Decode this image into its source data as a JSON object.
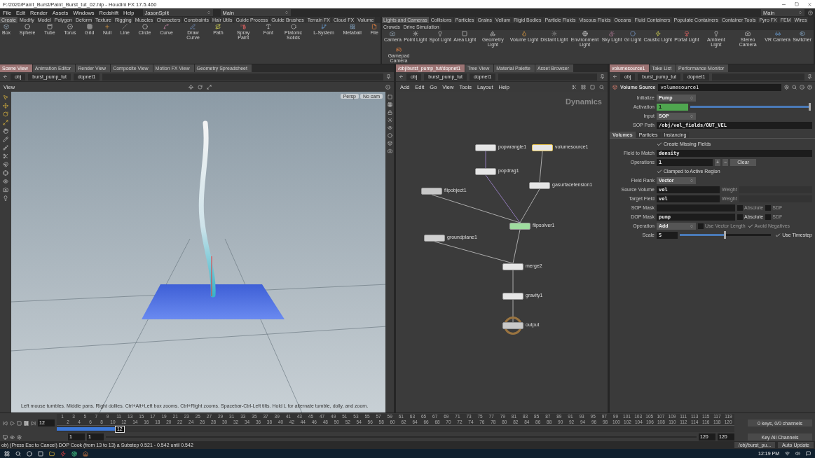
{
  "window": {
    "title": "F:/2020/Paint_Burst/Paint_Burst_tut_02.hip - Houdini FX 17.5.460"
  },
  "menu_bar": {
    "items": [
      "File",
      "Edit",
      "Render",
      "Assets",
      "Windows",
      "Redshift",
      "Help"
    ],
    "selectors": [
      "JasonSplit",
      "Main"
    ],
    "right_selector": "Main"
  },
  "shelves": [
    {
      "tabs": [
        {
          "label": "Create",
          "selected": true
        },
        {
          "label": "Modify",
          "selected": false
        },
        {
          "label": "Model",
          "selected": false
        },
        {
          "label": "Polygon",
          "selected": false
        },
        {
          "label": "Deform",
          "selected": false
        },
        {
          "label": "Texture",
          "selected": false
        },
        {
          "label": "Rigging",
          "selected": false
        },
        {
          "label": "Muscles",
          "selected": false
        },
        {
          "label": "Characters",
          "selected": false
        },
        {
          "label": "Constraints",
          "selected": false
        },
        {
          "label": "Hair Utils",
          "selected": false
        },
        {
          "label": "Guide Process",
          "selected": false
        },
        {
          "label": "Guide Brushes",
          "selected": false
        },
        {
          "label": "Terrain FX",
          "selected": false
        },
        {
          "label": "Cloud FX",
          "selected": false
        },
        {
          "label": "Volume",
          "selected": false
        }
      ],
      "tools": [
        "Box",
        "Sphere",
        "Tube",
        "Torus",
        "Grid",
        "Null",
        "Line",
        "Circle",
        "Curve",
        "Draw Curve",
        "Path",
        "Spray Paint",
        "Font",
        "Platonic Solids",
        "L-System",
        "Metaball",
        "File"
      ]
    },
    {
      "tabs": [
        {
          "label": "Lights and Cameras",
          "selected": true
        },
        {
          "label": "Collisions",
          "selected": false
        },
        {
          "label": "Particles",
          "selected": false
        },
        {
          "label": "Grains",
          "selected": false
        },
        {
          "label": "Vellum",
          "selected": false
        },
        {
          "label": "Rigid Bodies",
          "selected": false
        },
        {
          "label": "Particle Fluids",
          "selected": false
        },
        {
          "label": "Viscous Fluids",
          "selected": false
        },
        {
          "label": "Oceans",
          "selected": false
        },
        {
          "label": "Fluid Containers",
          "selected": false
        },
        {
          "label": "Populate Containers",
          "selected": false
        },
        {
          "label": "Container Tools",
          "selected": false
        },
        {
          "label": "Pyro FX",
          "selected": false
        },
        {
          "label": "FEM",
          "selected": false
        },
        {
          "label": "Wires",
          "selected": false
        },
        {
          "label": "Crowds",
          "selected": false
        },
        {
          "label": "Drive Simulation",
          "selected": false
        }
      ],
      "tools": [
        "Camera",
        "Point Light",
        "Spot Light",
        "Area Light",
        "Geometry Light",
        "Volume Light",
        "Distant Light",
        "Environment Light",
        "Sky Light",
        "GI Light",
        "Caustic Light",
        "Portal Light",
        "Ambient Light",
        "Stereo Camera",
        "VR Camera",
        "Switcher",
        "Gamepad Camera"
      ]
    }
  ],
  "panes": [
    {
      "tabs": [
        {
          "label": "Scene View",
          "selected": true
        },
        {
          "label": "Animation Editor",
          "selected": false
        },
        {
          "label": "Render View",
          "selected": false
        },
        {
          "label": "Composite View",
          "selected": false
        },
        {
          "label": "Motion FX View",
          "selected": false
        },
        {
          "label": "Geometry Spreadsheet",
          "selected": false
        }
      ],
      "path": [
        "obj",
        "burst_pump_tut",
        "dopnet1"
      ]
    },
    {
      "tabs": [
        {
          "label": "/obj/burst_pump_tut/dopnet1",
          "selected": true
        },
        {
          "label": "Tree View",
          "selected": false
        },
        {
          "label": "Material Palette",
          "selected": false
        },
        {
          "label": "Asset Browser",
          "selected": false
        }
      ],
      "path": [
        "obj",
        "burst_pump_tut",
        "dopnet1"
      ]
    },
    {
      "tabs": [
        {
          "label": "volumesource1",
          "selected": true
        },
        {
          "label": "Take List",
          "selected": false
        },
        {
          "label": "Performance Monitor",
          "selected": false
        }
      ],
      "path": [
        "obj",
        "burst_pump_tut",
        "dopnet1"
      ]
    }
  ],
  "viewport": {
    "header": "View",
    "camera": "Persp",
    "camera_lock": "No cam",
    "hint": "Left mouse tumbles. Middle pans. Right dollies. Ctrl+Alt+Left box zooms. Ctrl+Right zooms. Spacebar-Ctrl-Left tilts. Hold L for alternate tumble, dolly, and zoom."
  },
  "network": {
    "menu": [
      "Add",
      "Edit",
      "Go",
      "View",
      "Tools",
      "Layout",
      "Help"
    ],
    "context": "Dynamics",
    "nodes": [
      {
        "name": "popwrangle1",
        "selected": false,
        "display": false,
        "color": "#e6e6e6"
      },
      {
        "name": "volumesource1",
        "selected": true,
        "display": false,
        "color": "#e6e6e6"
      },
      {
        "name": "popdrag1",
        "selected": false,
        "display": false,
        "color": "#e6e6e6"
      },
      {
        "name": "gasurfacetension1",
        "selected": false,
        "display": false,
        "color": "#e6e6e6"
      },
      {
        "name": "flipobject1",
        "selected": false,
        "display": false,
        "color": "#c8c8c8"
      },
      {
        "name": "flipsolver1",
        "selected": false,
        "display": false,
        "color": "#9fdc9f"
      },
      {
        "name": "groundplane1",
        "selected": false,
        "display": false,
        "color": "#d0d0d0"
      },
      {
        "name": "merge2",
        "selected": false,
        "display": false,
        "color": "#e6e6e6"
      },
      {
        "name": "gravity1",
        "selected": false,
        "display": false,
        "color": "#e6e6e6"
      },
      {
        "name": "output",
        "selected": false,
        "display": true,
        "color": "#c8c8c8"
      }
    ]
  },
  "parameters": {
    "type": "Volume Source",
    "name": "volumesource1",
    "top_rows": [
      {
        "kind": "menu",
        "label": "Initialize",
        "value": "Pump"
      },
      {
        "kind": "slider",
        "label": "Activation",
        "value": "1",
        "level": 1,
        "animated": true
      },
      {
        "kind": "menu",
        "label": "Input",
        "value": "SOP"
      },
      {
        "kind": "field",
        "label": "SOP Path",
        "value": "/obj/vel_fields/OUT_VEL"
      }
    ],
    "tabs": [
      {
        "label": "Volumes",
        "selected": true
      },
      {
        "label": "Particles",
        "selected": false
      },
      {
        "label": "Instancing",
        "selected": false
      }
    ],
    "rows": [
      {
        "kind": "checkbox",
        "text": "Create Missing Fields",
        "checked": true
      },
      {
        "kind": "field",
        "label": "Field to Match",
        "value": "density"
      },
      {
        "kind": "multiparm",
        "label": "Operations",
        "value": "1",
        "buttons": [
          "+",
          "−"
        ],
        "action": "Clear"
      },
      {
        "kind": "checkbox",
        "text": "Clamped to Active Region",
        "checked": true
      },
      {
        "kind": "menu",
        "label": "Field Rank",
        "value": "Vector"
      },
      {
        "kind": "field",
        "label": "Source Volume",
        "value": "vel",
        "extra": "Weight"
      },
      {
        "kind": "field",
        "label": "Target Field",
        "value": "vel",
        "extra": "Weight"
      },
      {
        "kind": "field",
        "label": "SOP Mask",
        "options": [
          {
            "label": "Absolute",
            "checked": false,
            "disabled": true
          },
          {
            "label": "SDF",
            "checked": false,
            "disabled": true
          }
        ]
      },
      {
        "kind": "field",
        "label": "DOP Mask",
        "value": "pump",
        "options": [
          {
            "label": "Absolute",
            "checked": false,
            "disabled": false
          },
          {
            "label": "SDF",
            "checked": false,
            "disabled": true
          }
        ]
      },
      {
        "kind": "menu",
        "label": "Operation",
        "value": "Add",
        "options": [
          {
            "label": "Use Vector Length",
            "checked": false,
            "disabled": true
          },
          {
            "label": "Avoid Negatives",
            "checked": true,
            "disabled": true
          }
        ]
      },
      {
        "kind": "slider",
        "label": "Scale",
        "value": "5",
        "level": 0.5,
        "animated": false,
        "options": [
          {
            "label": "Use Timestep",
            "checked": true,
            "disabled": false
          }
        ]
      }
    ]
  },
  "timeline": {
    "playing": true,
    "frame": "12",
    "marker": "12",
    "level": 0.092,
    "ticks": [
      "1",
      "2",
      "3",
      "4",
      "5",
      "6",
      "7",
      "8",
      "9",
      "10",
      "11",
      "12",
      "13",
      "14",
      "15",
      "16",
      "17",
      "18",
      "19",
      "20",
      "21",
      "22",
      "23",
      "24",
      "25",
      "26",
      "27",
      "28",
      "29",
      "30",
      "31",
      "32",
      "33",
      "34",
      "35",
      "36",
      "37",
      "38",
      "39",
      "40",
      "41",
      "42",
      "43",
      "44",
      "45",
      "46",
      "47",
      "48",
      "49",
      "50",
      "51",
      "52",
      "53",
      "54",
      "55",
      "56",
      "57",
      "58",
      "59",
      "60",
      "61",
      "62",
      "63",
      "64",
      "65",
      "66",
      "67",
      "68",
      "69",
      "70",
      "71",
      "72",
      "73",
      "74",
      "75",
      "76",
      "77",
      "78",
      "79",
      "80",
      "81",
      "82",
      "83",
      "84",
      "85",
      "86",
      "87",
      "88",
      "89",
      "90",
      "91",
      "92",
      "93",
      "94",
      "95",
      "96",
      "97",
      "98",
      "99",
      "100",
      "101",
      "102",
      "103",
      "104",
      "105",
      "106",
      "107",
      "108",
      "109",
      "110",
      "111",
      "112",
      "113",
      "114",
      "115",
      "116",
      "117",
      "118",
      "119",
      "120"
    ],
    "range_start": [
      "1",
      "1"
    ],
    "range_end": [
      "120",
      "120"
    ],
    "keys": "0 keys, 0/0 channels",
    "key_mode": "Key All Channels"
  },
  "status": {
    "message": "ob) (Press Esc to Cancel) DOP Cook (from 13 to 13) a Substep 0.521 - 0.542 until 0.542",
    "path": "/obj/burst_pu...",
    "update": "Auto Update"
  },
  "taskbar": {
    "time": "12:19 PM"
  }
}
